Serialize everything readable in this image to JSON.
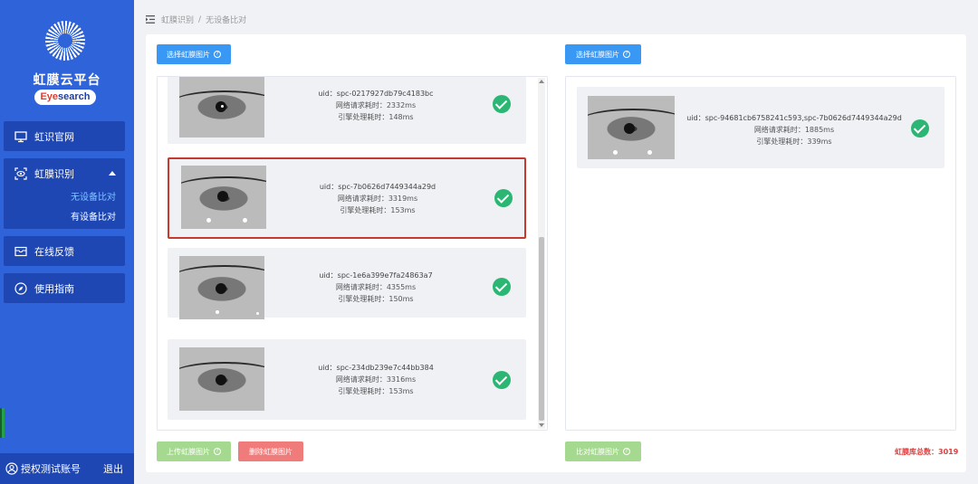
{
  "sidebar": {
    "platform_title": "虹膜云平台",
    "brand_prefix": "Eye",
    "brand_suffix": "search",
    "nav": {
      "official_site": "虹识官网",
      "iris_recognition": "虹膜识别",
      "sub_no_device": "无设备比对",
      "sub_with_device": "有设备比对",
      "feedback": "在线反馈",
      "guide": "使用指南"
    },
    "account_label": "授权测试账号",
    "logout_label": "退出"
  },
  "breadcrumb": {
    "parent": "虹膜识别",
    "separator": "/",
    "current": "无设备比对"
  },
  "left_panel": {
    "select_button": "选择虹膜图片",
    "upload_button": "上传虹膜图片",
    "delete_button": "删除虹膜图片",
    "items": [
      {
        "uid": "uid：spc-0217927db79c4183bc",
        "network": "网络请求耗时：2332ms",
        "engine": "引擎处理耗时：148ms"
      },
      {
        "uid": "uid：spc-7b0626d7449344a29d",
        "network": "网络请求耗时：3319ms",
        "engine": "引擎处理耗时：153ms"
      },
      {
        "uid": "uid：spc-1e6a399e7fa24863a7",
        "network": "网络请求耗时：4355ms",
        "engine": "引擎处理耗时：150ms"
      },
      {
        "uid": "uid：spc-234db239e7c44bb384",
        "network": "网络请求耗时：3316ms",
        "engine": "引擎处理耗时：153ms"
      }
    ]
  },
  "right_panel": {
    "select_button": "选择虹膜图片",
    "compare_button": "比对虹膜图片",
    "item": {
      "uid": "uid：spc-94681cb6758241c593,spc-7b0626d7449344a29d",
      "network": "网络请求耗时：1885ms",
      "engine": "引擎处理耗时：339ms"
    },
    "library_count": "虹膜库总数：3019"
  },
  "icons": {
    "menu": "menu-fold-icon",
    "monitor": "monitor-icon",
    "eye": "eye-scan-icon",
    "feedback": "mail-icon",
    "guide": "compass-icon",
    "user": "user-circle-icon",
    "check": "check-circle-icon",
    "help": "question-circle-icon"
  },
  "colors": {
    "sidebar_bg": "#2f63d9",
    "nav_bg": "#1e47b3",
    "primary": "#3a98f5",
    "success": "#2bb673",
    "danger": "#f07b7b",
    "selected_border": "#c43a2e",
    "count_red": "#e03c3c"
  }
}
